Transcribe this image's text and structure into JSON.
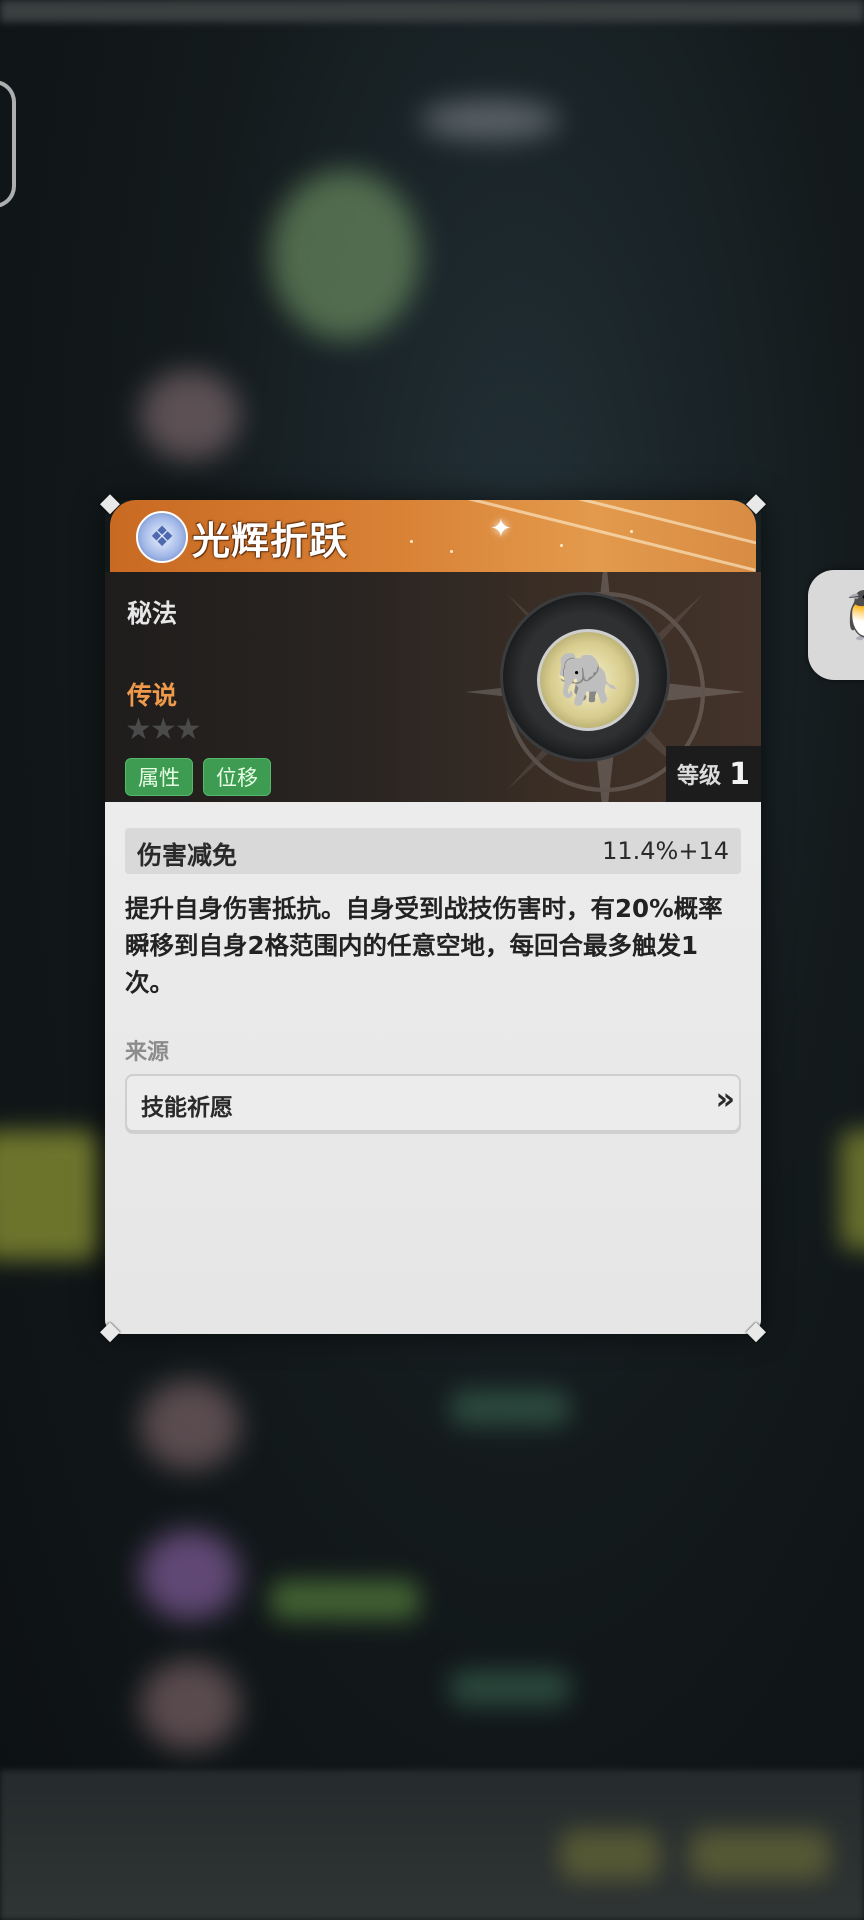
{
  "card": {
    "title": "光辉折跃",
    "type": "秘法",
    "rarity": "传说",
    "stars": "★★★",
    "tags": [
      "属性",
      "位移"
    ],
    "level_label": "等级",
    "level_value": "1",
    "stat": {
      "name": "伤害减免",
      "value": "11.4%+14"
    },
    "description": "提升自身伤害抵抗。自身受到战技伤害时，有20%概率瞬移到自身2格范围内的任意空地，每回合最多触发1次。",
    "source_label": "来源",
    "source_button": "技能祈愿",
    "source_arrow": "»"
  },
  "icons": {
    "skill_badge": "crystal-icon",
    "skill_art": "elephant-icon",
    "float_button": "penguin-icon"
  },
  "colors": {
    "header": "#d98236",
    "rarity": "#ef9a4a",
    "tag": "#3e9c52"
  }
}
